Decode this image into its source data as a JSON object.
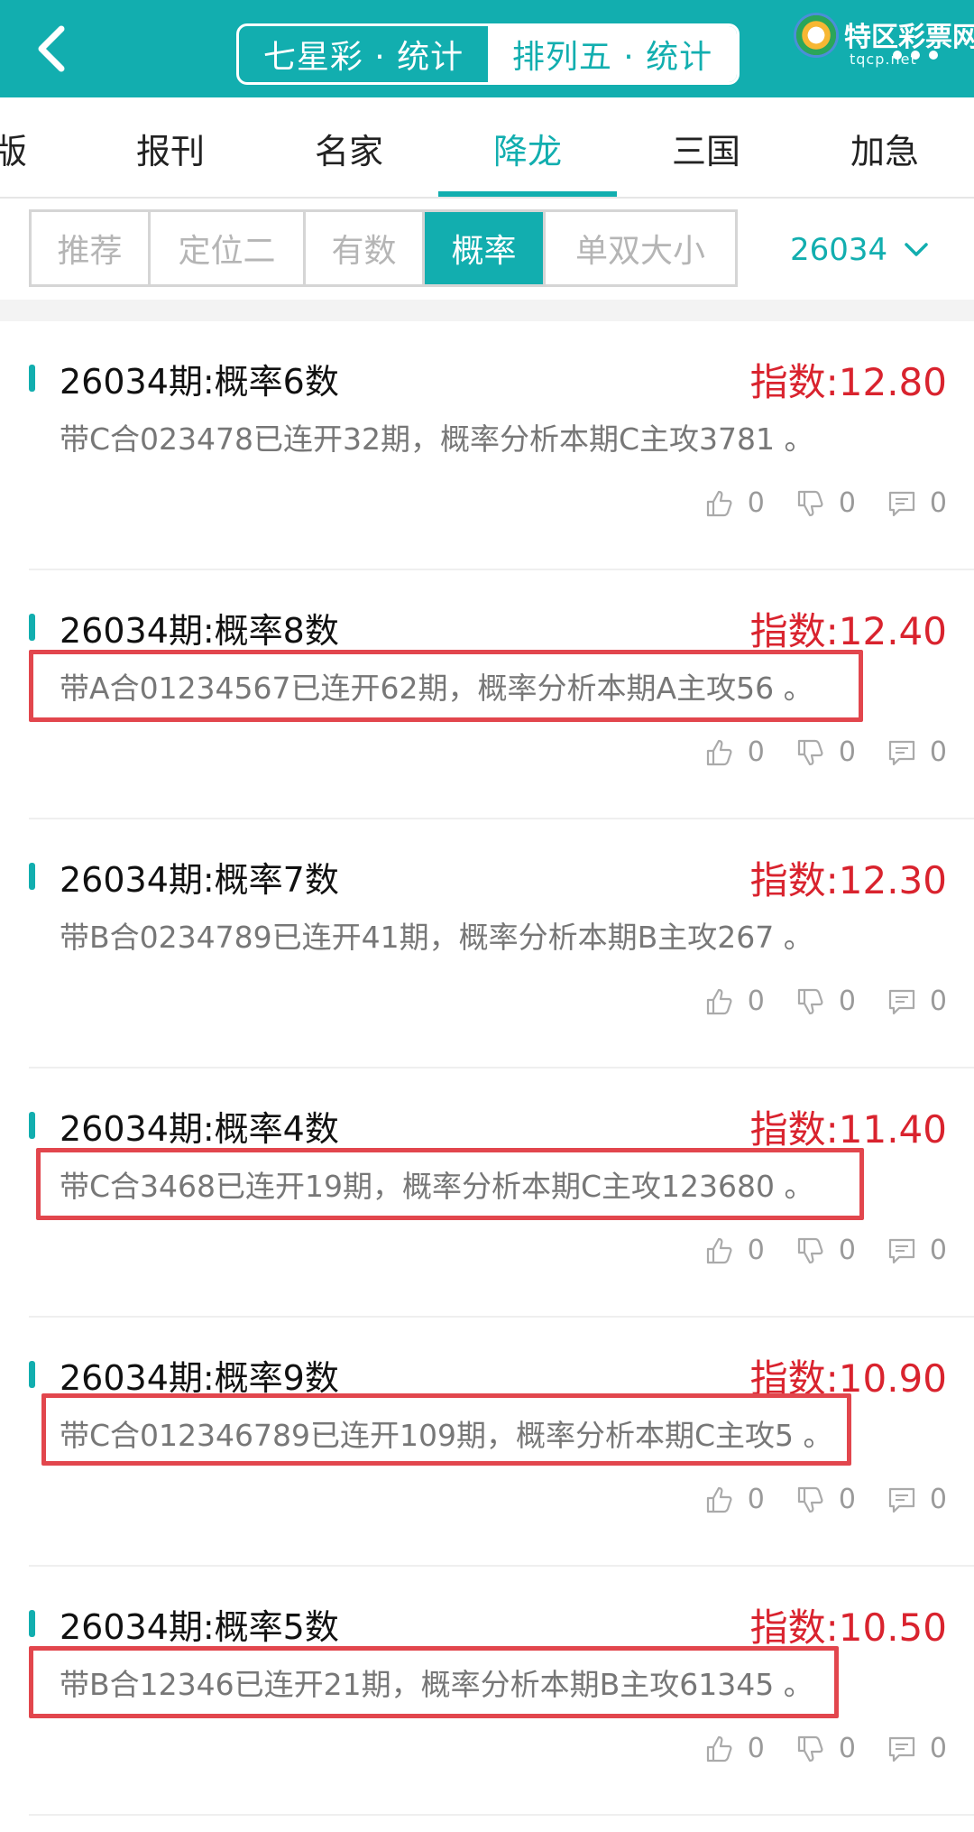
{
  "header": {
    "tabs": [
      {
        "label": "七星彩 · 统计",
        "active": false
      },
      {
        "label": "排列五 · 统计",
        "active": true
      }
    ],
    "logo_text": "特区彩票网",
    "logo_url": "tqcp.net"
  },
  "categories": [
    {
      "label": "版",
      "active": false
    },
    {
      "label": "报刊",
      "active": false
    },
    {
      "label": "名家",
      "active": false
    },
    {
      "label": "降龙",
      "active": true
    },
    {
      "label": "三国",
      "active": false
    },
    {
      "label": "加急",
      "active": false
    }
  ],
  "sub_tabs": [
    {
      "label": "推荐",
      "active": false
    },
    {
      "label": "定位二",
      "active": false
    },
    {
      "label": "有数",
      "active": false
    },
    {
      "label": "概率",
      "active": true
    },
    {
      "label": "单双大小",
      "active": false
    }
  ],
  "period": "26034",
  "accent_color": "#12aeaf",
  "index_color": "#d9232e",
  "highlight_color": "#e2464d",
  "cards": [
    {
      "title": "26034期:概率6数",
      "index": "指数:12.80",
      "desc": "带C合023478已连开32期，概率分析本期C主攻3781 。",
      "highlighted": false,
      "likes": "0",
      "dislikes": "0",
      "comments": "0"
    },
    {
      "title": "26034期:概率8数",
      "index": "指数:12.40",
      "desc": "带A合01234567已连开62期，概率分析本期A主攻56 。",
      "highlighted": true,
      "likes": "0",
      "dislikes": "0",
      "comments": "0"
    },
    {
      "title": "26034期:概率7数",
      "index": "指数:12.30",
      "desc": "带B合0234789已连开41期，概率分析本期B主攻267 。",
      "highlighted": false,
      "likes": "0",
      "dislikes": "0",
      "comments": "0"
    },
    {
      "title": "26034期:概率4数",
      "index": "指数:11.40",
      "desc": "带C合3468已连开19期，概率分析本期C主攻123680 。",
      "highlighted": true,
      "likes": "0",
      "dislikes": "0",
      "comments": "0"
    },
    {
      "title": "26034期:概率9数",
      "index": "指数:10.90",
      "desc": "带C合012346789已连开109期，概率分析本期C主攻5 。",
      "highlighted": true,
      "likes": "0",
      "dislikes": "0",
      "comments": "0"
    },
    {
      "title": "26034期:概率5数",
      "index": "指数:10.50",
      "desc": "带B合12346已连开21期，概率分析本期B主攻61345 。",
      "highlighted": true,
      "likes": "0",
      "dislikes": "0",
      "comments": "0"
    }
  ],
  "icons": {
    "back": "back-arrow-icon",
    "dropdown": "chevron-down-icon",
    "like": "thumbs-up-icon",
    "dislike": "thumbs-down-icon",
    "comment": "comment-icon",
    "logo": "logo-icon"
  }
}
